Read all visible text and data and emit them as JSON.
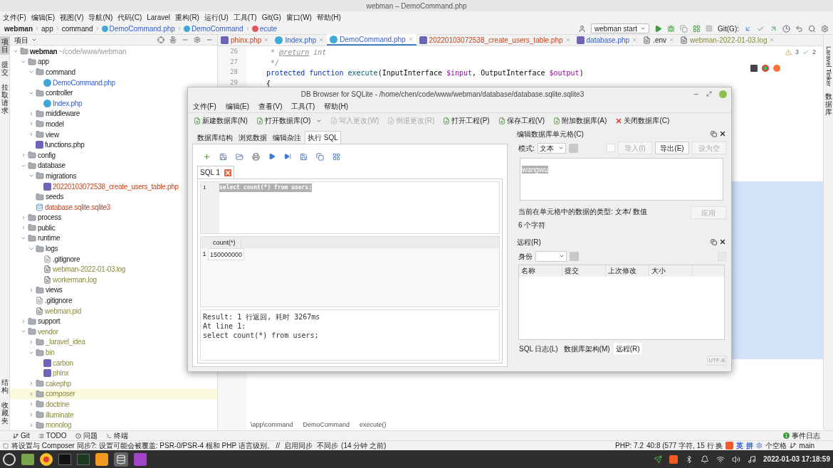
{
  "window": {
    "title": "webman – DemoCommand.php"
  },
  "menu": [
    "文件(F)",
    "编辑(E)",
    "视图(V)",
    "导航(N)",
    "代码(C)",
    "Laravel",
    "重构(R)",
    "运行(U)",
    "工具(T)",
    "Git(G)",
    "窗口(W)",
    "帮助(H)"
  ],
  "breadcrumb": [
    {
      "label": "webman",
      "kind": "project"
    },
    {
      "label": "app",
      "kind": "folder"
    },
    {
      "label": "command",
      "kind": "folder"
    },
    {
      "label": "DemoCommand.php",
      "kind": "class"
    },
    {
      "label": "DemoCommand",
      "kind": "class"
    },
    {
      "label": "ecute",
      "kind": "method"
    }
  ],
  "run_config": {
    "label": "webman start"
  },
  "git_label": "Git(G):",
  "left_strip": {
    "top": [
      {
        "label": "项目",
        "selected": true
      },
      {
        "label": "提交",
        "selected": false
      },
      {
        "label": "拉取请求",
        "selected": false
      }
    ],
    "bottom": [
      {
        "label": "结构",
        "selected": false
      },
      {
        "label": "收藏夹",
        "selected": false
      }
    ]
  },
  "right_strip": [
    {
      "label": "Laravel Tinker"
    },
    {
      "label": "数据库"
    }
  ],
  "project_panel": {
    "title": "项目",
    "tree": [
      {
        "name": "webman",
        "path": "~/code/www/webman",
        "kind": "folder",
        "expanded": true,
        "modified": false,
        "added": false,
        "ignored": false,
        "selected": false,
        "children": [
          {
            "name": "app",
            "kind": "folder",
            "expanded": true,
            "modified": false,
            "added": false,
            "ignored": false,
            "selected": false,
            "children": [
              {
                "name": "command",
                "kind": "folder",
                "expanded": true,
                "modified": false,
                "added": false,
                "ignored": false,
                "selected": false,
                "children": [
                  {
                    "name": "DemoCommand.php",
                    "kind": "class",
                    "modified": true,
                    "added": false,
                    "ignored": false,
                    "selected": false
                  }
                ]
              },
              {
                "name": "controller",
                "kind": "folder",
                "expanded": true,
                "modified": false,
                "added": false,
                "ignored": false,
                "selected": false,
                "children": [
                  {
                    "name": "Index.php",
                    "kind": "class",
                    "modified": true,
                    "added": false,
                    "ignored": false,
                    "selected": false
                  }
                ]
              },
              {
                "name": "middleware",
                "kind": "folder",
                "expanded": false,
                "modified": false,
                "added": false,
                "ignored": false,
                "selected": false
              },
              {
                "name": "model",
                "kind": "folder",
                "expanded": false,
                "modified": false,
                "added": false,
                "ignored": false,
                "selected": false
              },
              {
                "name": "view",
                "kind": "folder",
                "expanded": false,
                "modified": false,
                "added": false,
                "ignored": false,
                "selected": false
              },
              {
                "name": "functions.php",
                "kind": "php",
                "modified": false,
                "added": false,
                "ignored": false,
                "selected": false
              }
            ]
          },
          {
            "name": "config",
            "kind": "folder",
            "expanded": false,
            "modified": false,
            "added": false,
            "ignored": false,
            "selected": false
          },
          {
            "name": "database",
            "kind": "folder",
            "expanded": true,
            "modified": false,
            "added": false,
            "ignored": false,
            "selected": false,
            "children": [
              {
                "name": "migrations",
                "kind": "folder",
                "expanded": true,
                "modified": false,
                "added": false,
                "ignored": false,
                "selected": false,
                "children": [
                  {
                    "name": "20220103072538_create_users_table.php",
                    "kind": "php",
                    "modified": false,
                    "added": true,
                    "ignored": false,
                    "selected": false
                  }
                ]
              },
              {
                "name": "seeds",
                "kind": "empty-folder",
                "modified": false,
                "added": false,
                "ignored": false,
                "selected": false
              },
              {
                "name": "database.sqlite.sqlite3",
                "kind": "db",
                "modified": false,
                "added": true,
                "ignored": false,
                "selected": false
              }
            ]
          },
          {
            "name": "process",
            "kind": "folder",
            "expanded": false,
            "modified": false,
            "added": false,
            "ignored": false,
            "selected": false
          },
          {
            "name": "public",
            "kind": "folder",
            "expanded": false,
            "modified": false,
            "added": false,
            "ignored": false,
            "selected": false
          },
          {
            "name": "runtime",
            "kind": "folder",
            "expanded": true,
            "modified": false,
            "added": false,
            "ignored": false,
            "selected": false,
            "children": [
              {
                "name": "logs",
                "kind": "folder",
                "expanded": true,
                "modified": false,
                "added": false,
                "ignored": false,
                "selected": false,
                "children": [
                  {
                    "name": ".gitignore",
                    "kind": "gitignore",
                    "modified": false,
                    "added": false,
                    "ignored": false,
                    "selected": false
                  },
                  {
                    "name": "webman-2022-01-03.log",
                    "kind": "text",
                    "modified": false,
                    "added": false,
                    "ignored": true,
                    "selected": false
                  },
                  {
                    "name": "workerman.log",
                    "kind": "text",
                    "modified": false,
                    "added": false,
                    "ignored": true,
                    "selected": false
                  }
                ]
              },
              {
                "name": "views",
                "kind": "folder",
                "expanded": false,
                "modified": false,
                "added": false,
                "ignored": false,
                "selected": false
              },
              {
                "name": ".gitignore",
                "kind": "gitignore",
                "modified": false,
                "added": false,
                "ignored": false,
                "selected": false
              },
              {
                "name": "webman.pid",
                "kind": "text",
                "modified": false,
                "added": false,
                "ignored": true,
                "selected": false
              }
            ]
          },
          {
            "name": "support",
            "kind": "folder",
            "expanded": false,
            "modified": false,
            "added": false,
            "ignored": false,
            "selected": false
          },
          {
            "name": "vendor",
            "kind": "folder",
            "expanded": true,
            "modified": false,
            "added": false,
            "ignored": true,
            "selected": false,
            "children": [
              {
                "name": "_laravel_idea",
                "kind": "folder",
                "expanded": false,
                "modified": false,
                "added": false,
                "ignored": true,
                "selected": false
              },
              {
                "name": "bin",
                "kind": "folder",
                "expanded": true,
                "modified": false,
                "added": false,
                "ignored": true,
                "selected": false,
                "children": [
                  {
                    "name": "carbon",
                    "kind": "php",
                    "modified": false,
                    "added": false,
                    "ignored": true,
                    "selected": false
                  },
                  {
                    "name": "phinx",
                    "kind": "php",
                    "modified": false,
                    "added": false,
                    "ignored": true,
                    "selected": false
                  }
                ]
              },
              {
                "name": "cakephp",
                "kind": "folder",
                "expanded": false,
                "modified": false,
                "added": false,
                "ignored": true,
                "selected": false
              },
              {
                "name": "composer",
                "kind": "folder",
                "expanded": false,
                "modified": false,
                "added": false,
                "ignored": true,
                "selected": true
              },
              {
                "name": "doctrine",
                "kind": "folder",
                "expanded": false,
                "modified": false,
                "added": false,
                "ignored": true,
                "selected": false
              },
              {
                "name": "illuminate",
                "kind": "folder",
                "expanded": false,
                "modified": false,
                "added": false,
                "ignored": true,
                "selected": false
              },
              {
                "name": "monolog",
                "kind": "folder",
                "expanded": false,
                "modified": false,
                "added": false,
                "ignored": true,
                "selected": false
              }
            ]
          }
        ]
      }
    ]
  },
  "editor": {
    "tabs": [
      {
        "label": "phinx.php",
        "kind": "php",
        "modified": false,
        "added": true,
        "ignored": false,
        "selected": false
      },
      {
        "label": "Index.php",
        "kind": "class",
        "modified": true,
        "added": false,
        "ignored": false,
        "selected": false
      },
      {
        "label": "DemoCommand.php",
        "kind": "class",
        "modified": true,
        "added": false,
        "ignored": false,
        "selected": true
      },
      {
        "label": "20220103072538_create_users_table.php",
        "kind": "php",
        "modified": false,
        "added": true,
        "ignored": false,
        "selected": false
      },
      {
        "label": "database.php",
        "kind": "php",
        "modified": true,
        "added": false,
        "ignored": false,
        "selected": false
      },
      {
        "label": ".env",
        "kind": "text",
        "modified": false,
        "added": false,
        "ignored": false,
        "selected": false
      },
      {
        "label": "webman-2022-01-03.log",
        "kind": "text",
        "modified": false,
        "added": false,
        "ignored": true,
        "selected": false
      }
    ],
    "warnings": "3",
    "checks": "2",
    "lines": [
      {
        "number": "26",
        "tokens": [
          {
            "text": "     * ",
            "kind": "comment"
          },
          {
            "text": "@return",
            "kind": "tag"
          },
          {
            "text": " int",
            "kind": "comment"
          }
        ]
      },
      {
        "number": "27",
        "tokens": [
          {
            "text": "     */",
            "kind": "comment"
          }
        ]
      },
      {
        "number": "28",
        "tokens": [
          {
            "text": "    protected function ",
            "kind": "keyword"
          },
          {
            "text": "execute",
            "kind": "method"
          },
          {
            "text": "(InputInterface ",
            "kind": "plain"
          },
          {
            "text": "$input",
            "kind": "variable"
          },
          {
            "text": ", OutputInterface ",
            "kind": "plain"
          },
          {
            "text": "$output",
            "kind": "variable"
          },
          {
            "text": ")",
            "kind": "plain"
          }
        ]
      },
      {
        "number": "29",
        "tokens": [
          {
            "text": "    {",
            "kind": "plain"
          }
        ]
      }
    ],
    "footer": [
      "\\app\\command",
      "DemoCommand",
      "execute()"
    ]
  },
  "db_browser": {
    "title": "DB Browser for SQLite - /home/chen/code/www/webman/database/database.sqlite.sqlite3",
    "menu": [
      "文件(F)",
      "编辑(E)",
      "查看(V)",
      "工具(T)",
      "帮助(H)"
    ],
    "toolbar": [
      {
        "label": "新建数据库(N)",
        "disabled": false,
        "dropdown": false
      },
      {
        "label": "打开数据库(O)",
        "disabled": false,
        "dropdown": true
      },
      {
        "label": "写入更改(W)",
        "disabled": true,
        "dropdown": false
      },
      {
        "label": "倒退更改(R)",
        "disabled": true,
        "dropdown": false
      },
      {
        "label": "打开工程(P)",
        "disabled": false,
        "dropdown": false
      },
      {
        "label": "保存工程(V)",
        "disabled": false,
        "dropdown": false
      },
      {
        "label": "附加数据库(A)",
        "disabled": false,
        "dropdown": false
      },
      {
        "label": "关闭数据库(C)",
        "disabled": false,
        "dropdown": false
      }
    ],
    "tabs": [
      {
        "label": "数据库结构",
        "selected": false
      },
      {
        "label": "浏览数据",
        "selected": false
      },
      {
        "label": "编辑杂注",
        "selected": false
      },
      {
        "label": "执行 SQL",
        "selected": true
      }
    ],
    "sql_tab": {
      "label": "SQL 1"
    },
    "sql_lines": [
      {
        "number": "1",
        "text": "select count(*) from users;",
        "selected": true
      }
    ],
    "result": {
      "columns": [
        "count(*)"
      ],
      "rows": [
        {
          "number": "1",
          "cells": [
            "150000000"
          ]
        }
      ]
    },
    "messages": [
      "Result: 1 行返回, 耗时 3267ms",
      "At line 1:",
      "select count(*) from users;"
    ],
    "cell_editor": {
      "title": "编辑数据库单元格(C)",
      "mode_label": "模式:",
      "mode": "文本",
      "buttons": [
        {
          "label": "导入(I)",
          "disabled": true
        },
        {
          "label": "导出(E)",
          "disabled": false
        },
        {
          "label": "设为空",
          "disabled": true
        }
      ],
      "value": "wangwu",
      "type_info": "当前在单元格中的数据的类型: 文本/ 数值",
      "char_count": "6 个字符",
      "apply": {
        "label": "应用",
        "disabled": true
      }
    },
    "remote": {
      "title": "远程(R)",
      "identity_label": "身份",
      "columns": [
        "名称",
        "提交",
        "上次修改",
        "大小"
      ]
    },
    "dock_tabs": [
      {
        "label": "SQL 日志(L)",
        "selected": false
      },
      {
        "label": "数据库架构(M)",
        "selected": false
      },
      {
        "label": "远程(R)",
        "selected": true
      }
    ],
    "encoding": "UTF-8"
  },
  "tool_tabs": [
    {
      "label": "Git",
      "kind": "git"
    },
    {
      "label": "TODO",
      "kind": "todo"
    },
    {
      "label": "问题",
      "kind": "problems"
    },
    {
      "label": "终端",
      "kind": "terminal"
    }
  ],
  "event_log": {
    "label": "事件日志",
    "count": "1"
  },
  "status_bar": {
    "message": "将设置与 Composer 同步?: 设置可能会被覆盖: PSR-0/PSR-4 根和 PHP 语言级别。 //",
    "links": [
      "启用同步",
      "不同步"
    ],
    "time": "(14 分钟 之前)",
    "php": "PHP: 7.2",
    "position": "40:8 (577 字符, 15 行 换",
    "ime": [
      "英",
      "拼"
    ],
    "indent": "个空格",
    "branch": "main"
  },
  "taskbar": {
    "clock": "2022-01-03 17:18:59"
  }
}
